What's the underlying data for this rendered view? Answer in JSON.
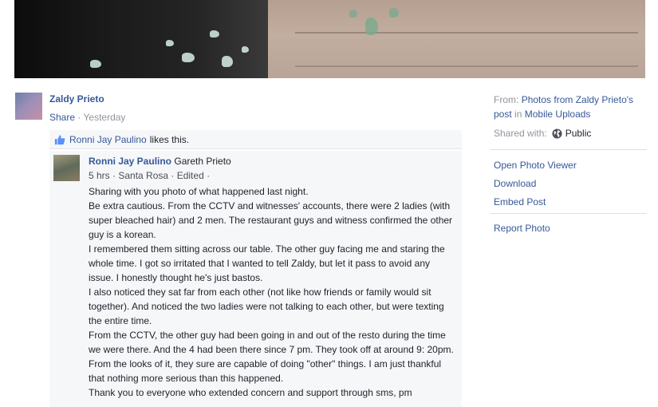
{
  "post": {
    "author": "Zaldy Prieto",
    "share_label": "Share",
    "separator": "·",
    "time": "Yesterday"
  },
  "likes": {
    "liker": "Ronni Jay Paulino",
    "rest": "likes this."
  },
  "comment": {
    "author": "Ronni Jay Paulino",
    "tagged": "Gareth Prieto",
    "meta": "5 hrs · Santa Rosa · Edited ·",
    "lines": [
      "Sharing with you photo of what happened last night.",
      "Be extra cautious. From the CCTV and witnesses' accounts, there were 2 ladies (with super bleached hair) and 2 men. The restaurant guys and witness confirmed the other guy is a korean.",
      "I remembered them sitting across our table. The other guy facing me and staring the whole time. I got so irritated that I wanted to tell Zaldy, but let it pass to avoid any issue. I honestly thought he's just bastos.",
      "I also noticed they sat far from each other (not like how friends or family would sit together). And noticed the two ladies were not talking to each other, but were texting the entire time.",
      "From the CCTV, the other guy had been going in and out of the resto during the time we were there. And the 4 had been there since 7 pm. They took off at around 9: 20pm.",
      "From the looks of it, they sure are capable of doing \"other\" things. I am just thankful that nothing more serious than this happened.",
      "Thank you to everyone who extended concern and support through sms, pm"
    ]
  },
  "sidebar": {
    "from_prefix": "From:",
    "from_link": "Photos from Zaldy Prieto's post",
    "from_in": "in",
    "from_album": "Mobile Uploads",
    "shared_with_label": "Shared with:",
    "shared_with_value": "Public",
    "links": [
      "Open Photo Viewer",
      "Download",
      "Embed Post",
      "Report Photo"
    ]
  },
  "colors": {
    "link": "#365899",
    "muted": "#90949c",
    "comment_bg": "#f6f7f9"
  }
}
